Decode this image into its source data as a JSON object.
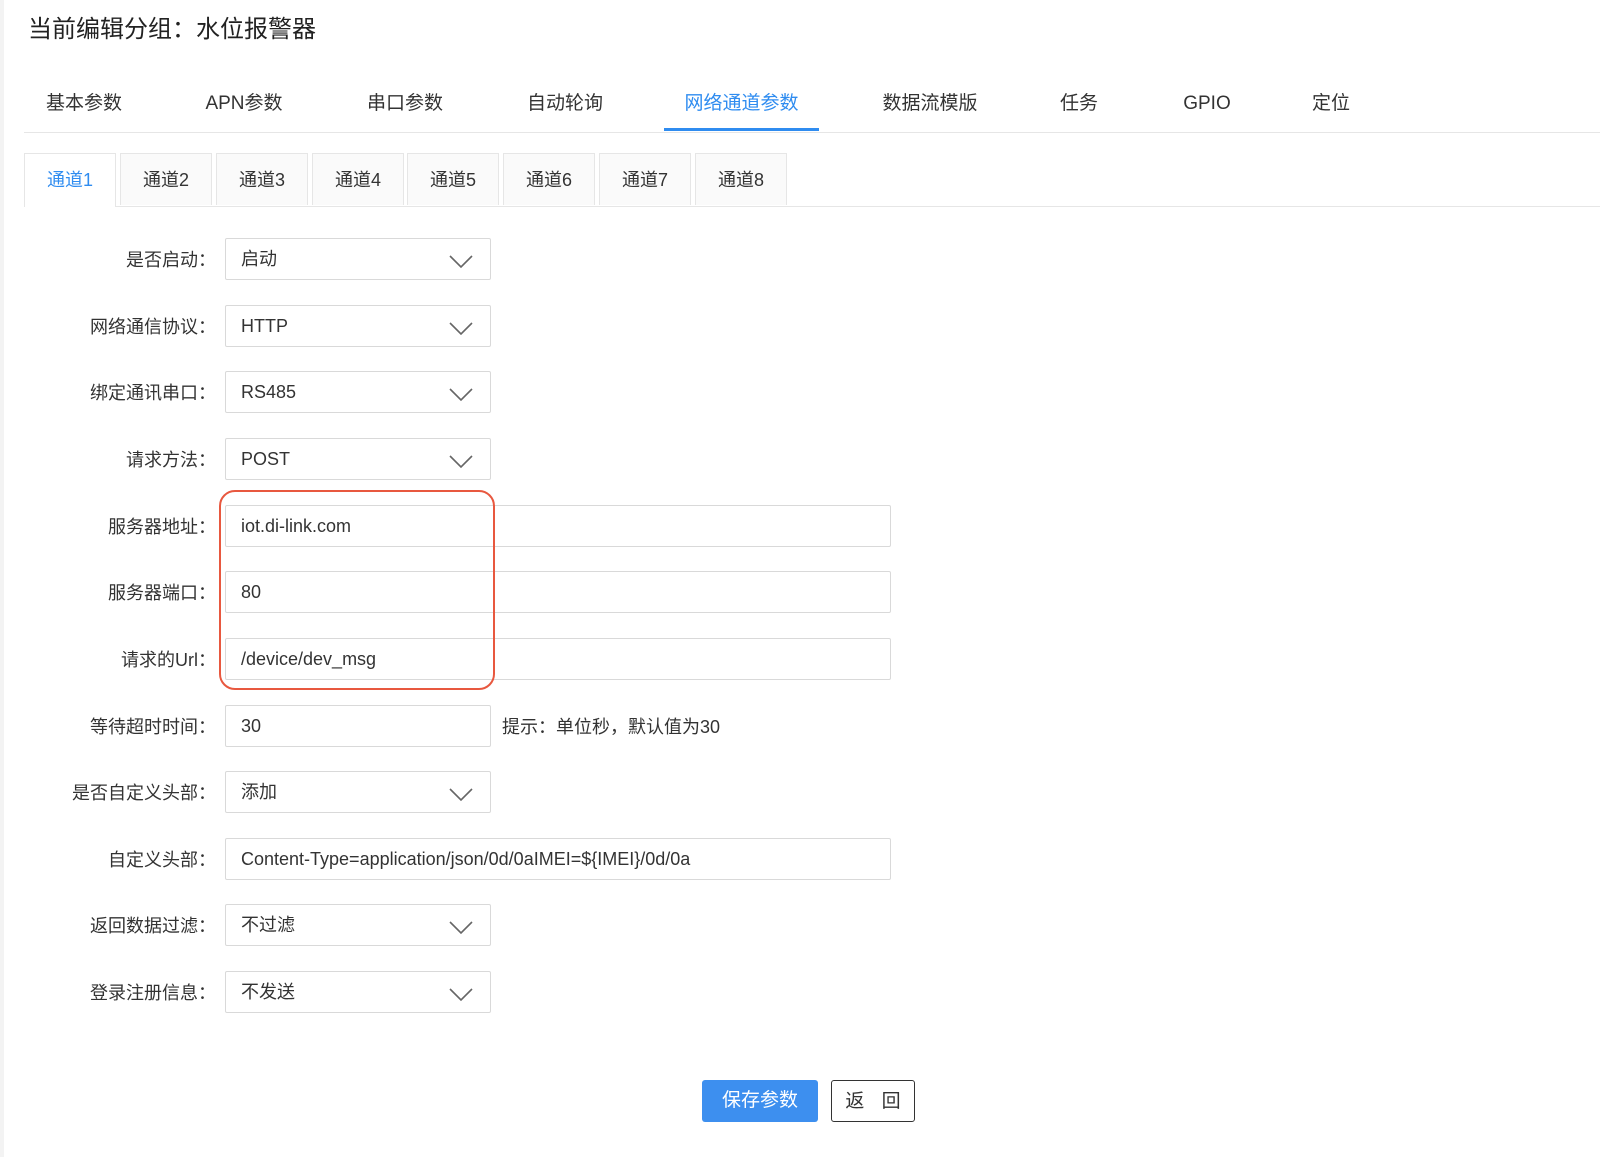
{
  "page_title": "当前编辑分组：水位报警器",
  "main_tabs": [
    {
      "label": "基本参数"
    },
    {
      "label": "APN参数"
    },
    {
      "label": "串口参数"
    },
    {
      "label": "自动轮询"
    },
    {
      "label": "网络通道参数",
      "active": true
    },
    {
      "label": "数据流模版"
    },
    {
      "label": "任务"
    },
    {
      "label": "GPIO"
    },
    {
      "label": "定位"
    }
  ],
  "channel_tabs": [
    {
      "label": "通道1",
      "active": true
    },
    {
      "label": "通道2"
    },
    {
      "label": "通道3"
    },
    {
      "label": "通道4"
    },
    {
      "label": "通道5"
    },
    {
      "label": "通道6"
    },
    {
      "label": "通道7"
    },
    {
      "label": "通道8"
    }
  ],
  "form": {
    "enabled": {
      "label": "是否启动：",
      "value": "启动"
    },
    "protocol": {
      "label": "网络通信协议：",
      "value": "HTTP"
    },
    "serial_port": {
      "label": "绑定通讯串口：",
      "value": "RS485"
    },
    "method": {
      "label": "请求方法：",
      "value": "POST"
    },
    "server_address": {
      "label": "服务器地址：",
      "value": "iot.di-link.com"
    },
    "server_port": {
      "label": "服务器端口：",
      "value": "80"
    },
    "request_url": {
      "label": "请求的Url：",
      "value": "/device/dev_msg"
    },
    "timeout": {
      "label": "等待超时时间：",
      "value": "30",
      "hint": "提示：单位秒，默认值为30"
    },
    "custom_header_enabled": {
      "label": "是否自定义头部：",
      "value": "添加"
    },
    "custom_header": {
      "label": "自定义头部：",
      "value": "Content-Type=application/json/0d/0aIMEI=${IMEI}/0d/0a"
    },
    "response_filter": {
      "label": "返回数据过滤：",
      "value": "不过滤"
    },
    "login_info": {
      "label": "登录注册信息：",
      "value": "不发送"
    }
  },
  "buttons": {
    "save": "保存参数",
    "back": "返 回"
  },
  "colors": {
    "accent": "#2f8cf0",
    "highlight": "#e8583f",
    "primary_button": "#3d8fef"
  },
  "icons": {
    "select_arrow": "chevron-down-icon"
  }
}
